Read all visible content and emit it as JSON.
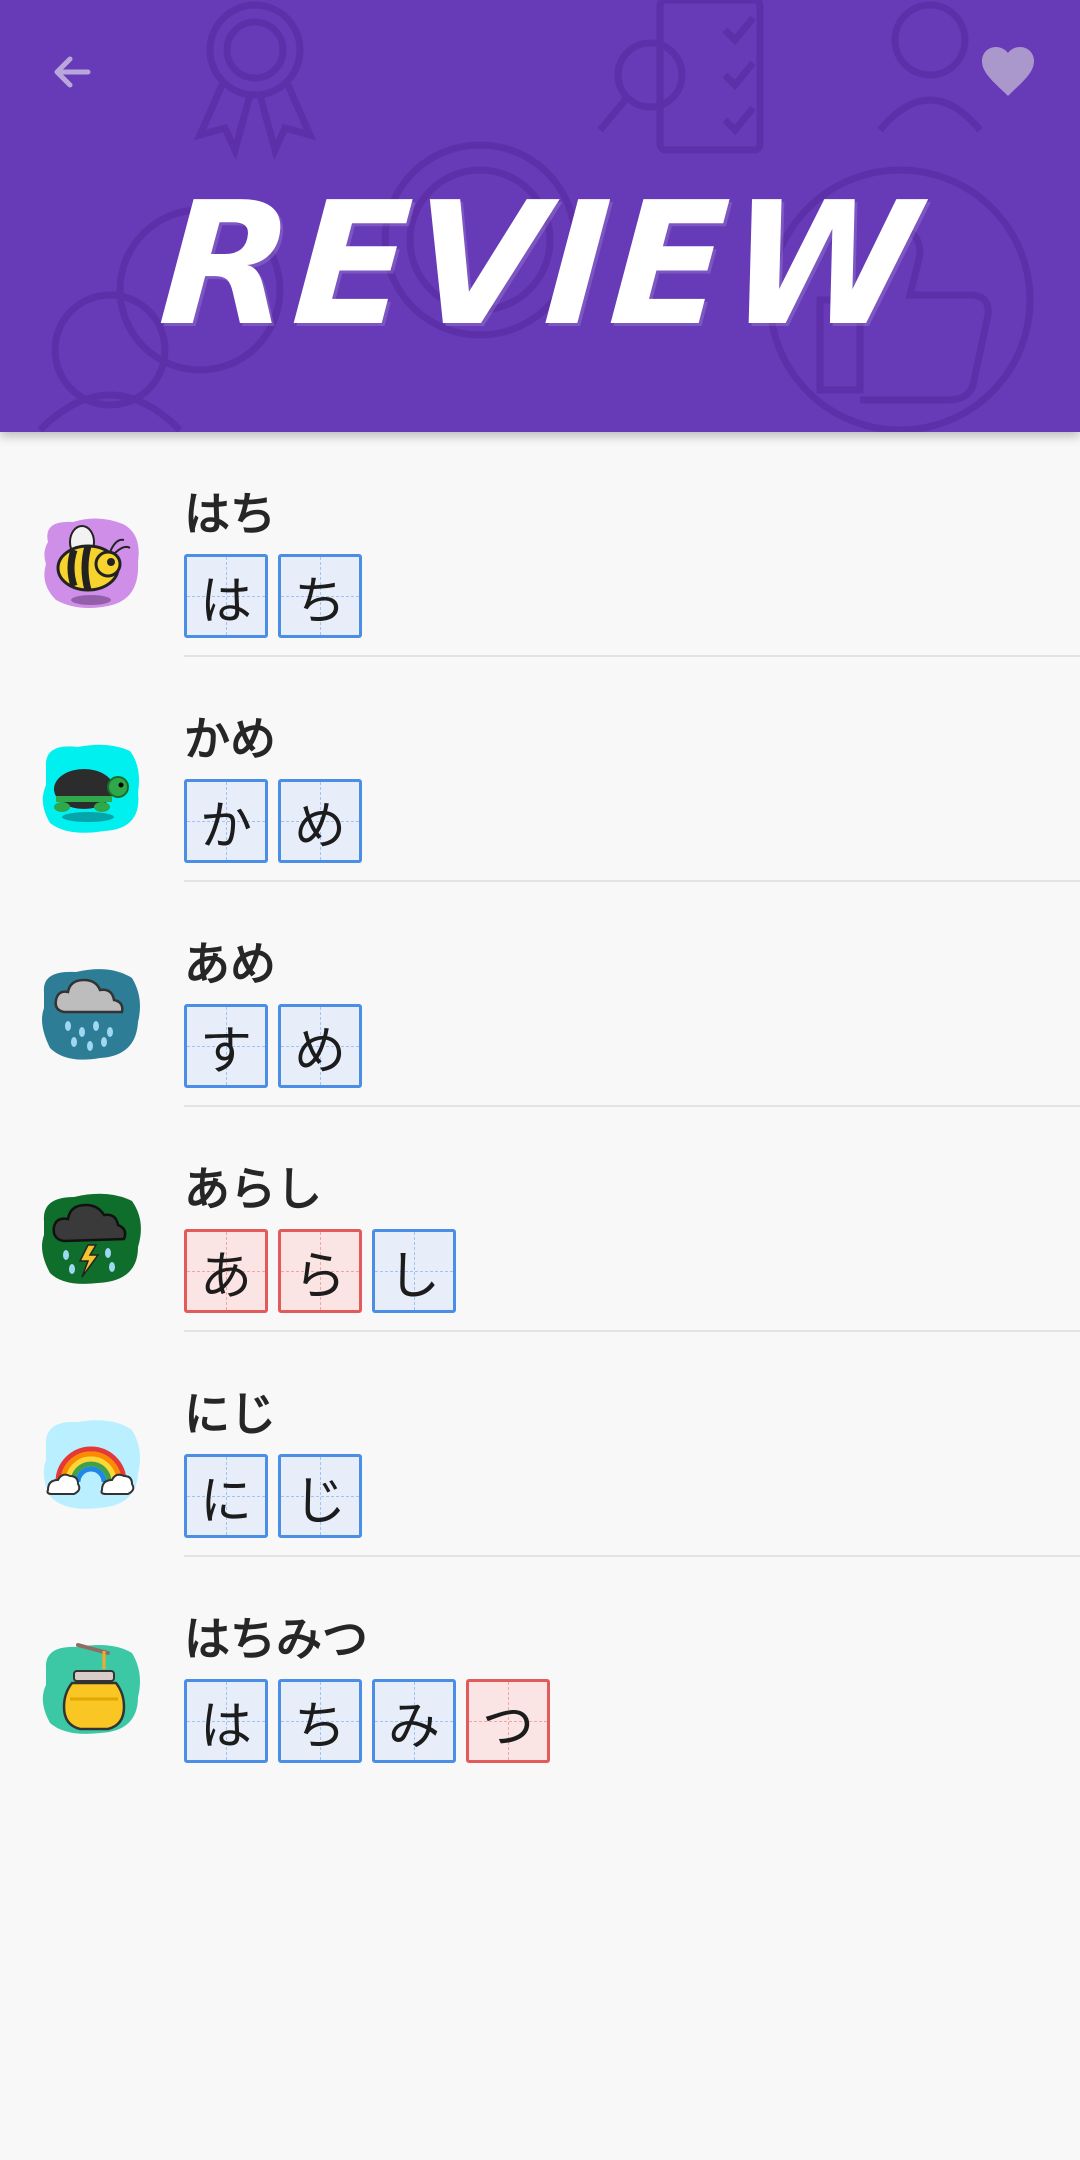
{
  "header": {
    "title": "REVIEW",
    "bg_color": "#673ab7",
    "back_icon": "arrow-back-icon",
    "favorite_icon": "heart-icon"
  },
  "colors": {
    "correct_border": "#4a8ee6",
    "correct_fill": "#e7eef9",
    "wrong_border": "#e35a5a",
    "wrong_fill": "#fbe4e4"
  },
  "items": [
    {
      "word": "はち",
      "icon": "bee-icon",
      "thumb_color": "#cf8fe8",
      "chars": [
        {
          "char": "は",
          "status": "correct"
        },
        {
          "char": "ち",
          "status": "correct"
        }
      ]
    },
    {
      "word": "かめ",
      "icon": "turtle-icon",
      "thumb_color": "#00f0f0",
      "chars": [
        {
          "char": "か",
          "status": "correct"
        },
        {
          "char": "め",
          "status": "correct"
        }
      ]
    },
    {
      "word": "あめ",
      "icon": "rain-cloud-icon",
      "thumb_color": "#2e7d96",
      "chars": [
        {
          "char": "す",
          "status": "correct"
        },
        {
          "char": "め",
          "status": "correct"
        }
      ]
    },
    {
      "word": "あらし",
      "icon": "storm-cloud-icon",
      "thumb_color": "#0f6e2c",
      "chars": [
        {
          "char": "あ",
          "status": "wrong"
        },
        {
          "char": "ら",
          "status": "wrong"
        },
        {
          "char": "し",
          "status": "correct"
        }
      ]
    },
    {
      "word": "にじ",
      "icon": "rainbow-icon",
      "thumb_color": "#b9efff",
      "chars": [
        {
          "char": "に",
          "status": "correct"
        },
        {
          "char": "じ",
          "status": "correct"
        }
      ]
    },
    {
      "word": "はちみつ",
      "icon": "honey-jar-icon",
      "thumb_color": "#3cc8a5",
      "chars": [
        {
          "char": "は",
          "status": "correct"
        },
        {
          "char": "ち",
          "status": "correct"
        },
        {
          "char": "み",
          "status": "correct"
        },
        {
          "char": "つ",
          "status": "wrong"
        }
      ]
    }
  ]
}
